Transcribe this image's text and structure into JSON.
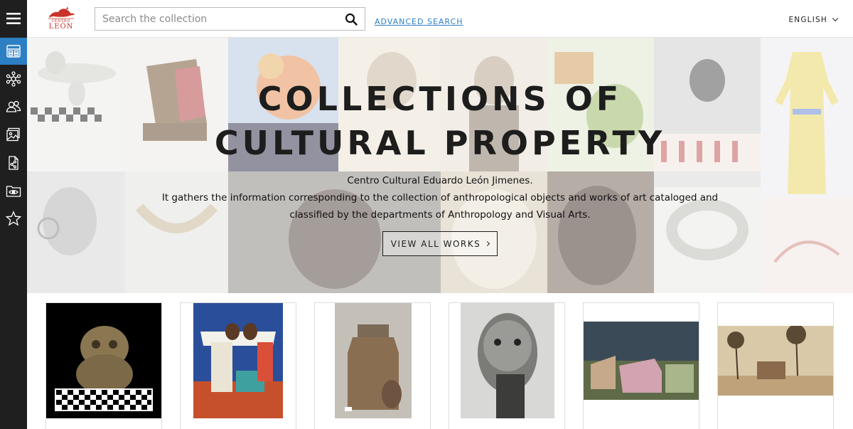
{
  "sidebar": {
    "items": [
      {
        "icon": "hamburger-menu-icon"
      },
      {
        "icon": "collection-grid-icon",
        "active": true
      },
      {
        "icon": "network-icon"
      },
      {
        "icon": "people-icon"
      },
      {
        "icon": "gallery-image-icon"
      },
      {
        "icon": "share-document-icon"
      },
      {
        "icon": "eye-folder-icon"
      },
      {
        "icon": "star-icon"
      }
    ],
    "background": "#1f1f1f",
    "active_color": "#2d7fc4"
  },
  "header": {
    "logo_top": "CENTRO",
    "logo_text": "LEÓN",
    "search_placeholder": "Search the collection",
    "advanced_search": "ADVANCED SEARCH",
    "language": "ENGLISH"
  },
  "hero": {
    "title_line1": "COLLECTIONS OF",
    "title_line2": "CULTURAL PROPERTY",
    "subtitle_line1": "Centro Cultural Eduardo León Jimenes.",
    "subtitle_line2": "It gathers the information corresponding to the collection of anthropological objects and works of art cataloged and",
    "subtitle_line3": "classified by the departments of Anthropology and Visual Arts.",
    "button_label": "VIEW ALL WORKS"
  },
  "cards": [
    {
      "name": "stone-figure-artwork"
    },
    {
      "name": "painting-women-artwork"
    },
    {
      "name": "metal-milk-can-artwork"
    },
    {
      "name": "portrait-photograph-artwork"
    },
    {
      "name": "houses-landscape-artwork"
    },
    {
      "name": "palm-trees-landscape-artwork"
    }
  ],
  "colors": {
    "accent": "#2d7fc4",
    "logo_red": "#c8342a"
  }
}
